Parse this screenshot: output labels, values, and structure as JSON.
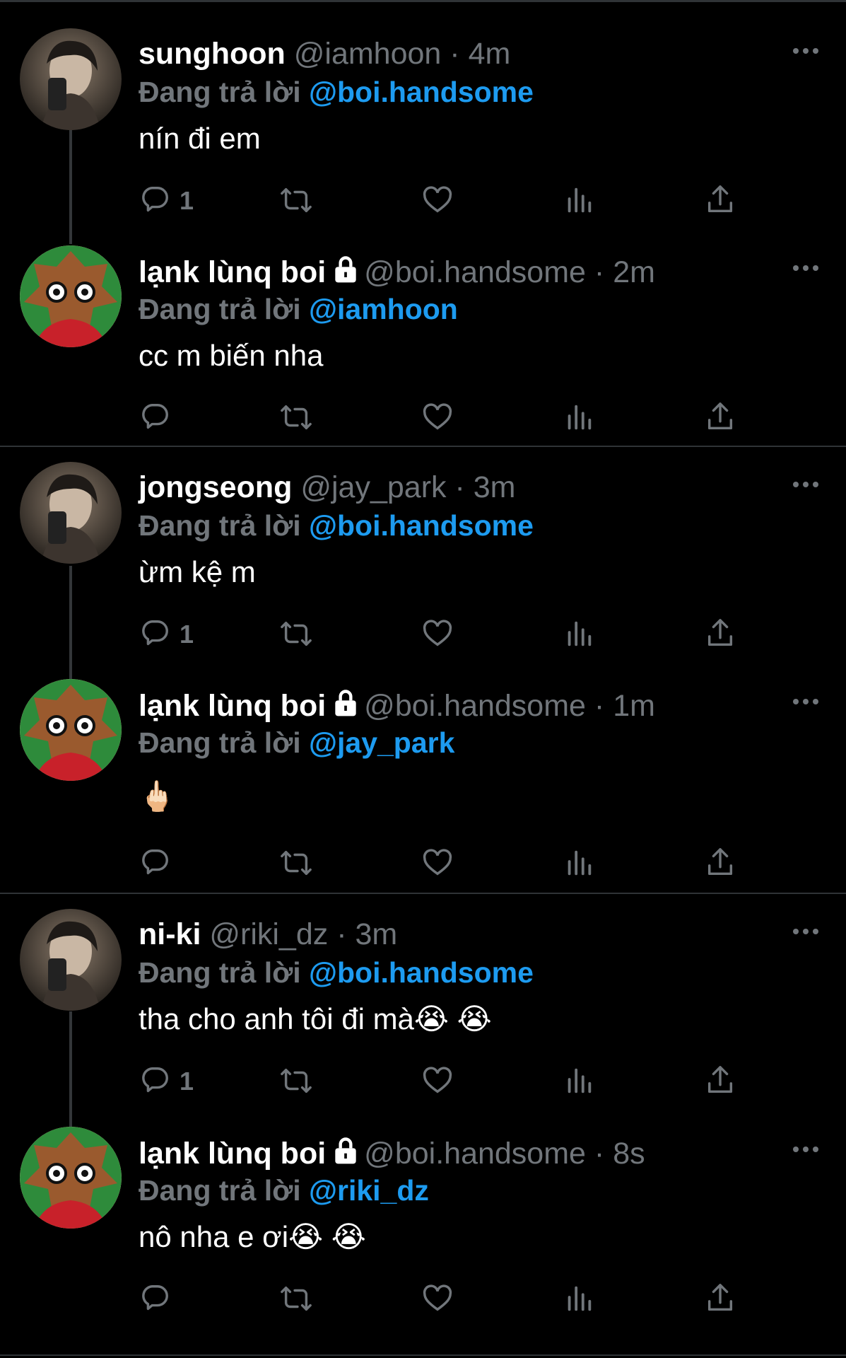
{
  "colors": {
    "background": "#000000",
    "text": "#ffffff",
    "muted": "#71767b",
    "accent": "#1d9bf0",
    "divider": "#2f3336"
  },
  "tweets": [
    {
      "name": "sunghoon",
      "handle": "@iamhoon",
      "dot": "·",
      "time": "4m",
      "locked": false,
      "reply_prefix": "Đang trả lời ",
      "reply_to": "@boi.handsome",
      "text": "nín đi em",
      "reply_count": "1",
      "avatar": "selfie-phone-avatar"
    },
    {
      "name": "lạnk lùnq boi",
      "handle": "@boi.handsome",
      "dot": "·",
      "time": "2m",
      "locked": true,
      "reply_prefix": "Đang trả lời ",
      "reply_to": "@iamhoon",
      "text": "cc m biến nha",
      "reply_count": "",
      "avatar": "cartoon-leaf-avatar"
    },
    {
      "name": "jongseong",
      "handle": "@jay_park",
      "dot": "·",
      "time": "3m",
      "locked": false,
      "reply_prefix": "Đang trả lời ",
      "reply_to": "@boi.handsome",
      "text": "ừm kệ m",
      "reply_count": "1",
      "avatar": "portrait-avatar"
    },
    {
      "name": "lạnk lùnq boi",
      "handle": "@boi.handsome",
      "dot": "·",
      "time": "1m",
      "locked": true,
      "reply_prefix": "Đang trả lời ",
      "reply_to": "@jay_park",
      "text": "🖕🏻",
      "reply_count": "",
      "avatar": "cartoon-leaf-avatar"
    },
    {
      "name": "ni-ki",
      "handle": "@riki_dz",
      "dot": "·",
      "time": "3m",
      "locked": false,
      "reply_prefix": "Đang trả lời ",
      "reply_to": "@boi.handsome",
      "text": "tha cho anh tôi đi mà😭 😭",
      "reply_count": "1",
      "avatar": "mirror-selfie-avatar"
    },
    {
      "name": "lạnk lùnq boi",
      "handle": "@boi.handsome",
      "dot": "·",
      "time": "8s",
      "locked": true,
      "reply_prefix": "Đang trả lời ",
      "reply_to": "@riki_dz",
      "text": "nô nha e ơi😭 😭",
      "reply_count": "",
      "avatar": "cartoon-leaf-avatar"
    }
  ],
  "action_icons": [
    "reply-icon",
    "retweet-icon",
    "like-icon",
    "views-icon",
    "share-icon"
  ]
}
